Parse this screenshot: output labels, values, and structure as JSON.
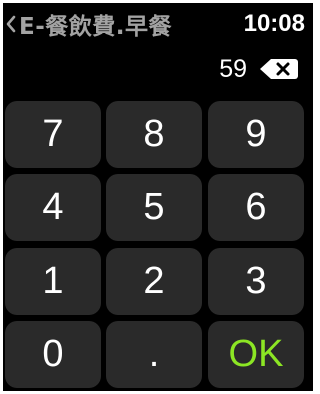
{
  "header": {
    "back_icon": "chevron-left-icon",
    "title": "E-餐飲費.早餐",
    "time": "10:08"
  },
  "display": {
    "amount": "59",
    "delete_icon": "backspace-icon"
  },
  "keypad": {
    "keys": [
      "7",
      "8",
      "9",
      "4",
      "5",
      "6",
      "1",
      "2",
      "3",
      "0",
      ".",
      "OK"
    ],
    "ok_color": "#8ce624"
  }
}
